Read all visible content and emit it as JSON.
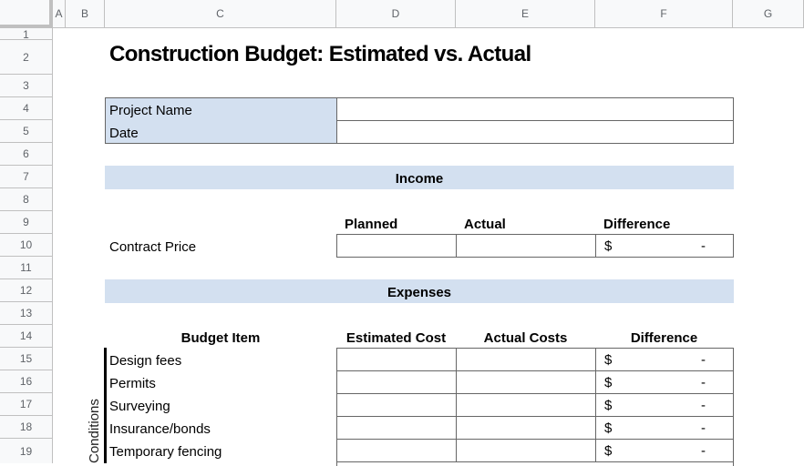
{
  "sheet": {
    "columns": [
      "A",
      "B",
      "C",
      "D",
      "E",
      "F",
      "G"
    ],
    "rows": [
      "1",
      "2",
      "3",
      "4",
      "5",
      "6",
      "7",
      "8",
      "9",
      "10",
      "11",
      "12",
      "13",
      "14",
      "15",
      "16",
      "17",
      "18",
      "19"
    ]
  },
  "title": "Construction Budget: Estimated vs. Actual",
  "project_info": {
    "project_name_label": "Project Name",
    "project_name_value": "",
    "date_label": "Date",
    "date_value": ""
  },
  "income": {
    "section_label": "Income",
    "headers": {
      "planned": "Planned",
      "actual": "Actual",
      "difference": "Difference"
    },
    "rows": [
      {
        "label": "Contract Price",
        "planned": "",
        "actual": "",
        "currency": "$",
        "difference": "-"
      }
    ]
  },
  "expenses": {
    "section_label": "Expenses",
    "headers": {
      "item": "Budget Item",
      "estimated": "Estimated Cost",
      "actual": "Actual Costs",
      "difference": "Difference"
    },
    "group_label": "Conditions",
    "rows": [
      {
        "label": "Design fees",
        "estimated": "",
        "actual": "",
        "currency": "$",
        "difference": "-"
      },
      {
        "label": "Permits",
        "estimated": "",
        "actual": "",
        "currency": "$",
        "difference": "-"
      },
      {
        "label": "Surveying",
        "estimated": "",
        "actual": "",
        "currency": "$",
        "difference": "-"
      },
      {
        "label": "Insurance/bonds",
        "estimated": "",
        "actual": "",
        "currency": "$",
        "difference": "-"
      },
      {
        "label": "Temporary fencing",
        "estimated": "",
        "actual": "",
        "currency": "$",
        "difference": "-"
      }
    ]
  }
}
